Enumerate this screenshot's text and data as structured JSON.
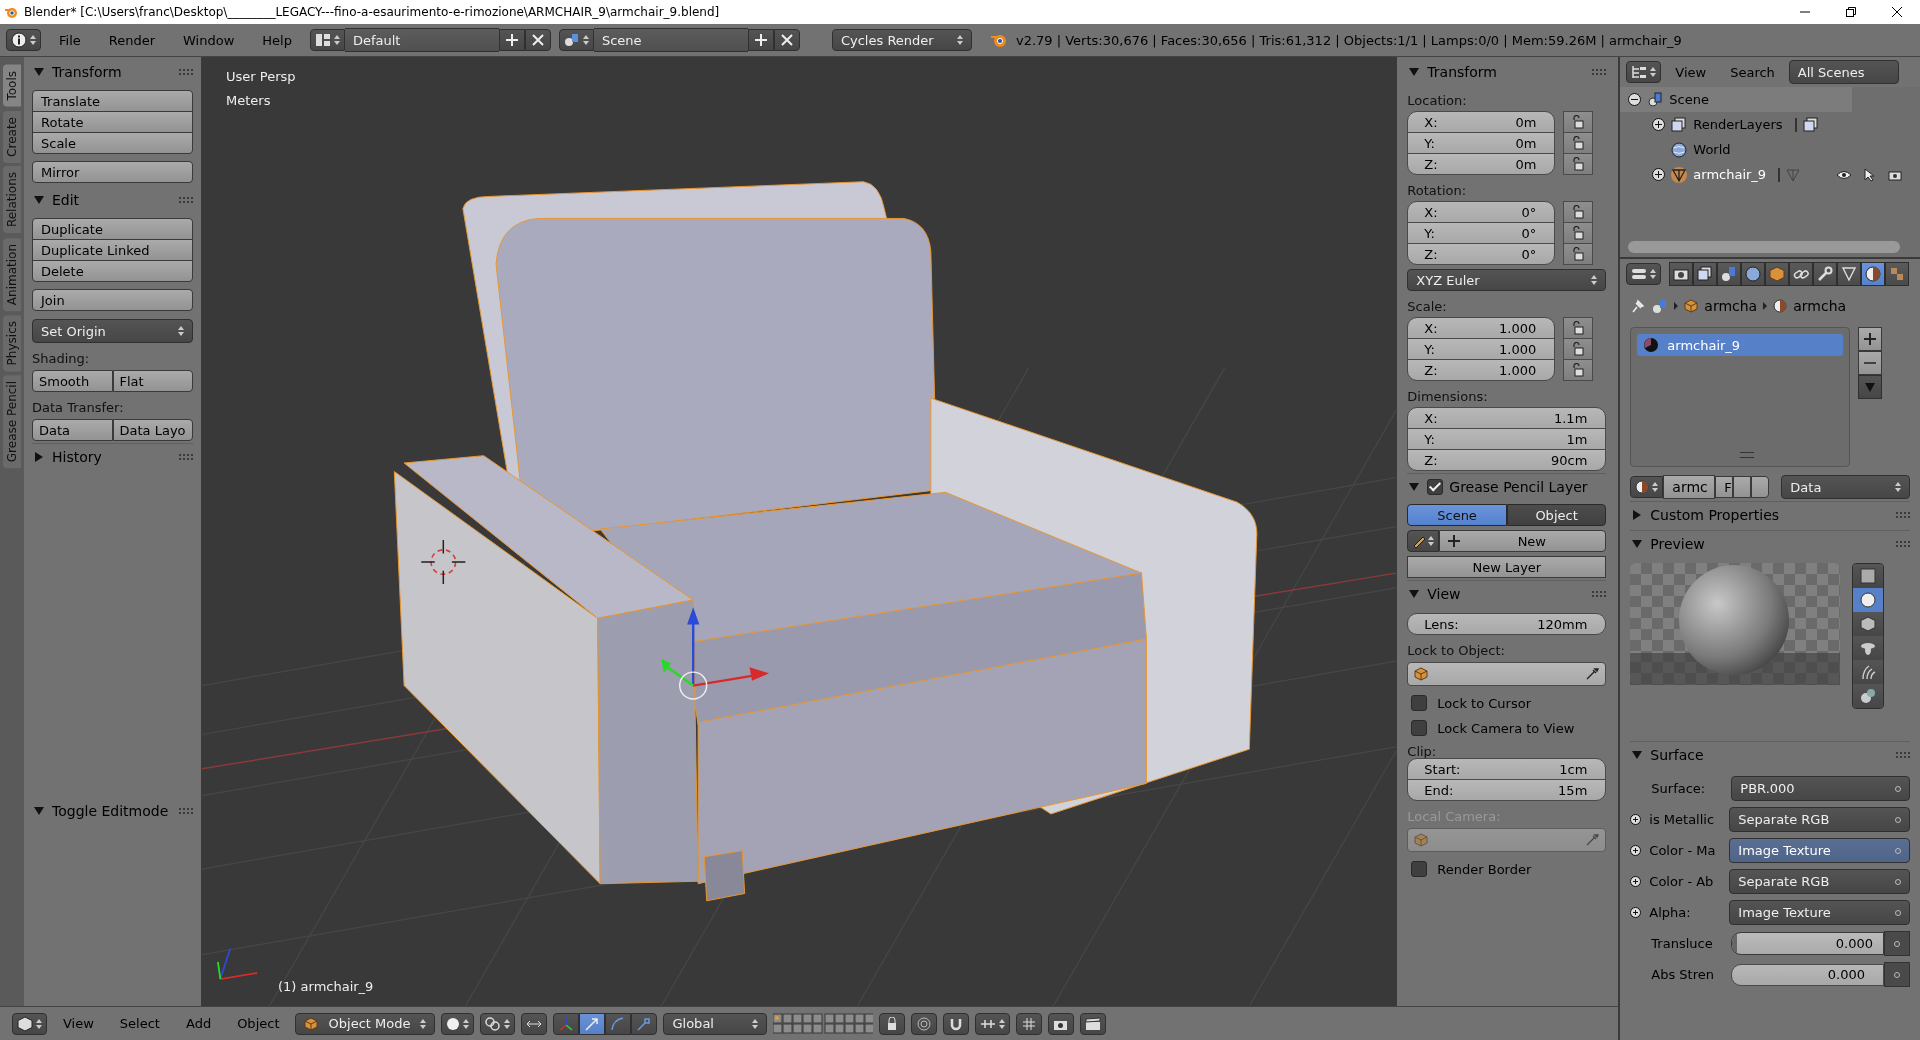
{
  "window": {
    "title": "Blender* [C:\\Users\\franc\\Desktop\\________LEGACY---fino-a-esaurimento-e-rimozione\\ARMCHAIR_9\\armchair_9.blend]"
  },
  "header": {
    "menus": [
      "File",
      "Render",
      "Window",
      "Help"
    ],
    "layout": "Default",
    "scene": "Scene",
    "engine": "Cycles Render",
    "stats": "v2.79 | Verts:30,676 | Faces:30,656 | Tris:61,312 | Objects:1/1 | Lamps:0/0 | Mem:59.26M | armchair_9"
  },
  "tool_tabs": [
    {
      "label": "Tools",
      "selected": true
    },
    {
      "label": "Create",
      "selected": false
    },
    {
      "label": "Relations",
      "selected": false
    },
    {
      "label": "Animation",
      "selected": false
    },
    {
      "label": "Physics",
      "selected": false
    },
    {
      "label": "Grease Pencil",
      "selected": false
    }
  ],
  "tool_panel": {
    "transform": {
      "title": "Transform",
      "expanded": true,
      "groups": [
        [
          "Translate",
          "Rotate",
          "Scale"
        ],
        [
          "Mirror"
        ]
      ]
    },
    "edit": {
      "title": "Edit",
      "expanded": true,
      "groups": [
        [
          "Duplicate",
          "Duplicate Linked",
          "Delete"
        ],
        [
          "Join"
        ]
      ],
      "set_origin": "Set Origin",
      "shading_label": "Shading:",
      "shading": [
        "Smooth",
        "Flat"
      ],
      "data_transfer_label": "Data Transfer:",
      "data_transfer": [
        "Data",
        "Data Layo"
      ]
    },
    "history": {
      "title": "History",
      "expanded": false
    },
    "toggle_editmode": {
      "title": "Toggle Editmode",
      "expanded": true
    }
  },
  "viewport": {
    "view_name": "User Persp",
    "units": "Meters",
    "object_label": "(1) armchair_9"
  },
  "sidebar": {
    "transform": {
      "title": "Transform",
      "expanded": true,
      "groups": [
        {
          "label": "Location:",
          "locks": true,
          "fields": [
            {
              "axis": "X:",
              "value": "0m"
            },
            {
              "axis": "Y:",
              "value": "0m"
            },
            {
              "axis": "Z:",
              "value": "0m"
            }
          ]
        },
        {
          "label": "Rotation:",
          "locks": true,
          "fields": [
            {
              "axis": "X:",
              "value": "0°"
            },
            {
              "axis": "Y:",
              "value": "0°"
            },
            {
              "axis": "Z:",
              "value": "0°"
            }
          ],
          "mode": "XYZ Euler"
        },
        {
          "label": "Scale:",
          "locks": true,
          "fields": [
            {
              "axis": "X:",
              "value": "1.000"
            },
            {
              "axis": "Y:",
              "value": "1.000"
            },
            {
              "axis": "Z:",
              "value": "1.000"
            }
          ]
        },
        {
          "label": "Dimensions:",
          "locks": false,
          "fields": [
            {
              "axis": "X:",
              "value": "1.1m"
            },
            {
              "axis": "Y:",
              "value": "1m"
            },
            {
              "axis": "Z:",
              "value": "90cm"
            }
          ]
        }
      ]
    },
    "grease_pencil": {
      "title": "Grease Pencil Layer",
      "expanded": true,
      "checked": true,
      "tabs": [
        {
          "label": "Scene",
          "selected": true
        },
        {
          "label": "Object",
          "selected": false
        }
      ],
      "new": "New",
      "new_layer": "New Layer"
    },
    "view": {
      "title": "View",
      "expanded": true,
      "lens_label": "Lens:",
      "lens": "120mm",
      "lock_label": "Lock to Object:",
      "checks": [
        {
          "label": "Lock to Cursor",
          "checked": false
        },
        {
          "label": "Lock Camera to View",
          "checked": false
        }
      ],
      "clip_label": "Clip:",
      "clip": [
        {
          "label": "Start:",
          "value": "1cm"
        },
        {
          "label": "End:",
          "value": "15m"
        }
      ],
      "local_camera_label": "Local Camera:",
      "local_camera_disabled": true,
      "render_border": {
        "label": "Render Border",
        "checked": false
      }
    }
  },
  "outliner": {
    "menus": [
      "View",
      "Search"
    ],
    "display": "All Scenes",
    "tree": [
      {
        "name": "Scene",
        "kind": "scene",
        "expanded": true,
        "selected": true,
        "children": [
          {
            "name": "RenderLayers",
            "kind": "render_layers",
            "expanded": false,
            "selected": false
          },
          {
            "name": "World",
            "kind": "world",
            "selected": false
          },
          {
            "name": "armchair_9",
            "kind": "mesh_object",
            "expanded": false,
            "selected": false
          }
        ]
      }
    ]
  },
  "properties": {
    "tabs": [
      {
        "kind": "render",
        "selected": false
      },
      {
        "kind": "render_layers",
        "selected": false
      },
      {
        "kind": "scene",
        "selected": false
      },
      {
        "kind": "world",
        "selected": false
      },
      {
        "kind": "object",
        "selected": false
      },
      {
        "kind": "constraints",
        "selected": false
      },
      {
        "kind": "modifiers",
        "selected": false
      },
      {
        "kind": "data",
        "selected": false
      },
      {
        "kind": "material",
        "selected": true
      },
      {
        "kind": "texture",
        "selected": false
      }
    ],
    "breadcrumb": [
      "armcha",
      "armcha"
    ],
    "slots": [
      {
        "name": "armchair_9",
        "selected": true
      }
    ],
    "material": {
      "name": "armc",
      "fake_user": "F",
      "link": "Data"
    },
    "panels": [
      {
        "title": "Custom Properties",
        "expanded": false
      },
      {
        "title": "Preview",
        "expanded": true
      },
      {
        "title": "Surface",
        "expanded": true
      }
    ],
    "preview_shapes": [
      {
        "kind": "plane",
        "selected": false
      },
      {
        "kind": "sphere",
        "selected": true
      },
      {
        "kind": "cube",
        "selected": false
      },
      {
        "kind": "monkey",
        "selected": false
      },
      {
        "kind": "hair",
        "selected": false
      },
      {
        "kind": "sphere_group",
        "selected": false
      }
    ],
    "surface": [
      {
        "kind": "node",
        "label": "Surface:",
        "value": "PBR.000",
        "expandable": false,
        "selected": false
      },
      {
        "kind": "node",
        "label": "is Metallic",
        "value": "Separate RGB",
        "expandable": true,
        "selected": false
      },
      {
        "kind": "node",
        "label": "Color - Ma",
        "value": "Image Texture",
        "expandable": true,
        "selected": true
      },
      {
        "kind": "node",
        "label": "Color - Ab",
        "value": "Separate RGB",
        "expandable": true,
        "selected": false
      },
      {
        "kind": "node",
        "label": "Alpha:",
        "value": "Image Texture",
        "expandable": true,
        "selected": false
      },
      {
        "kind": "slider",
        "label": "Transluce",
        "value": "0.000",
        "level": 0.03
      },
      {
        "kind": "number",
        "label": "Abs Stren",
        "value": "0.000"
      }
    ]
  },
  "bottom_bar": {
    "menus": [
      "View",
      "Select",
      "Add",
      "Object"
    ],
    "mode": "Object Mode",
    "orientation": "Global"
  }
}
